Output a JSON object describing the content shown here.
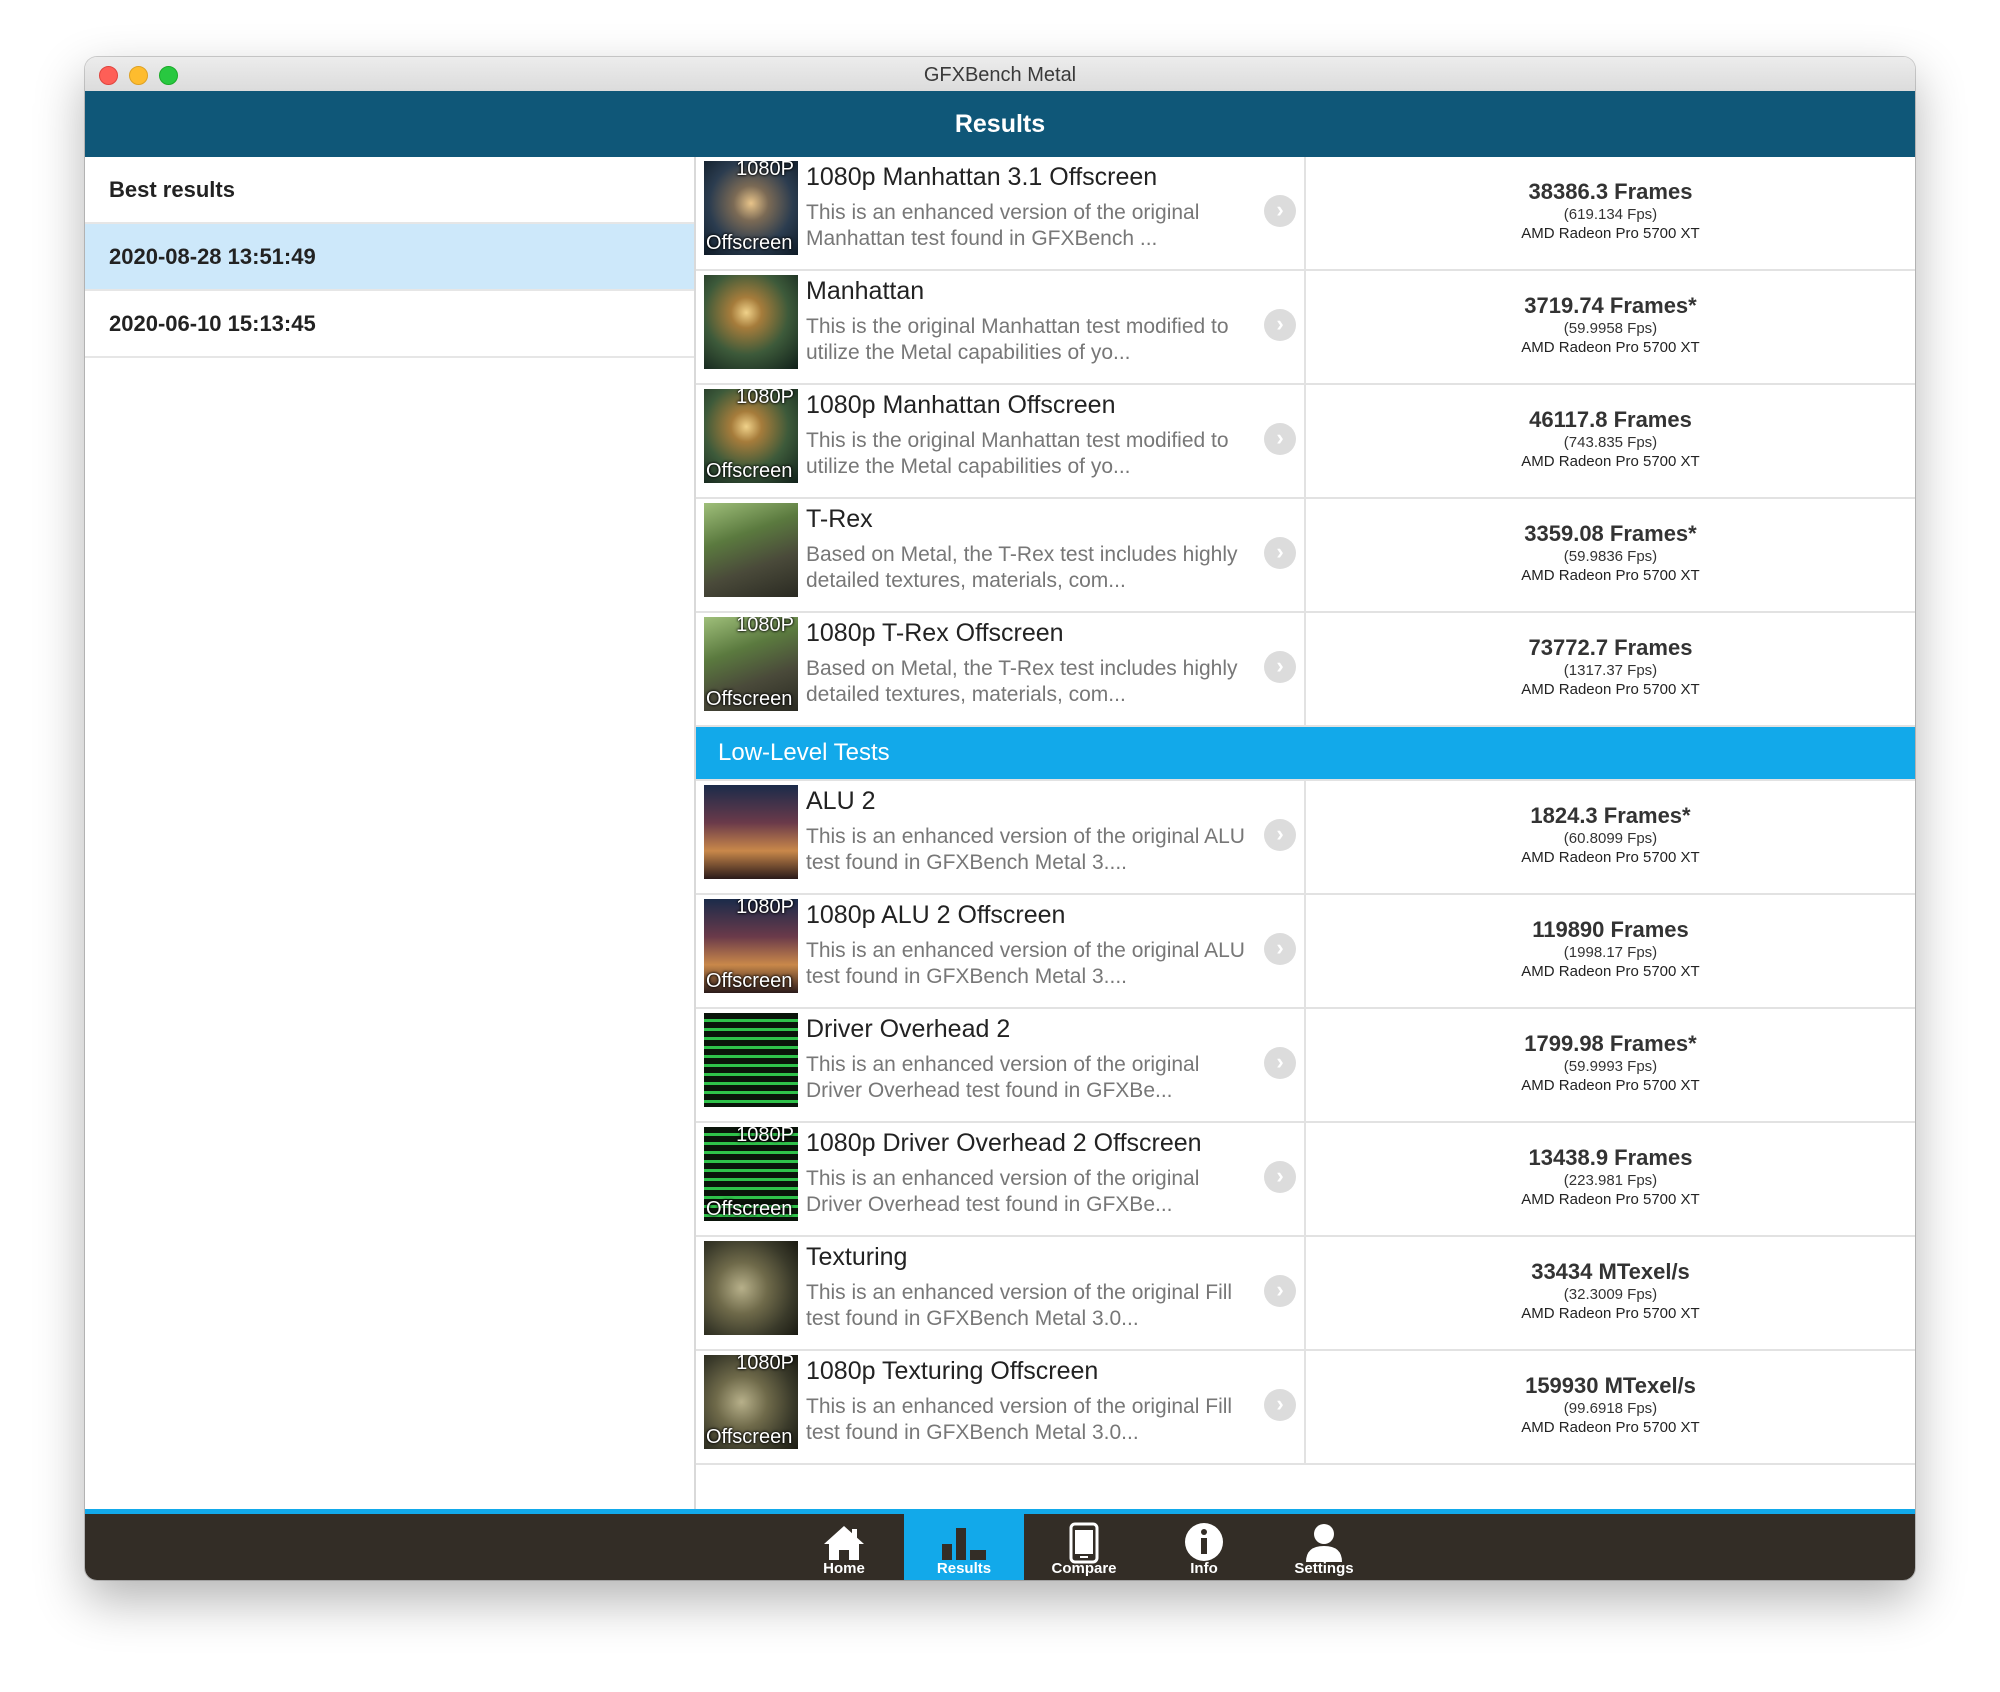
{
  "window": {
    "title": "GFXBench Metal"
  },
  "header": {
    "title": "Results"
  },
  "sidebar": {
    "items": [
      {
        "label": "Best results",
        "active": false
      },
      {
        "label": "2020-08-28 13:51:49",
        "active": true
      },
      {
        "label": "2020-06-10 15:13:45",
        "active": false
      }
    ]
  },
  "thumb_overlay": {
    "top": "1080P",
    "bottom": "Offscreen"
  },
  "section_low_level": "Low-Level Tests",
  "results_high": [
    {
      "title": "1080p Manhattan 3.1 Offscreen",
      "desc": "This is an enhanced version of the original Manhattan test found in GFXBench ...",
      "frames": "38386.3 Frames",
      "fps": "(619.134 Fps)",
      "gpu": "AMD Radeon Pro 5700 XT"
    },
    {
      "title": "Manhattan",
      "desc": "This is the original Manhattan test modified to utilize the Metal capabilities of yo...",
      "frames": "3719.74 Frames*",
      "fps": "(59.9958 Fps)",
      "gpu": "AMD Radeon Pro 5700 XT"
    },
    {
      "title": "1080p Manhattan Offscreen",
      "desc": "This is the original Manhattan test modified to utilize the Metal capabilities of yo...",
      "frames": "46117.8 Frames",
      "fps": "(743.835 Fps)",
      "gpu": "AMD Radeon Pro 5700 XT"
    },
    {
      "title": "T-Rex",
      "desc": "Based on Metal, the T-Rex test includes highly detailed textures, materials, com...",
      "frames": "3359.08 Frames*",
      "fps": "(59.9836 Fps)",
      "gpu": "AMD Radeon Pro 5700 XT"
    },
    {
      "title": "1080p T-Rex Offscreen",
      "desc": "Based on Metal, the T-Rex test includes highly detailed textures, materials, com...",
      "frames": "73772.7 Frames",
      "fps": "(1317.37 Fps)",
      "gpu": "AMD Radeon Pro 5700 XT"
    }
  ],
  "results_low": [
    {
      "title": "ALU 2",
      "desc": "This is an enhanced version of the original ALU test found in GFXBench Metal 3....",
      "frames": "1824.3 Frames*",
      "fps": "(60.8099 Fps)",
      "gpu": "AMD Radeon Pro 5700 XT"
    },
    {
      "title": "1080p ALU 2 Offscreen",
      "desc": "This is an enhanced version of the original ALU test found in GFXBench Metal 3....",
      "frames": "119890 Frames",
      "fps": "(1998.17 Fps)",
      "gpu": "AMD Radeon Pro 5700 XT"
    },
    {
      "title": "Driver Overhead 2",
      "desc": "This is an enhanced version of the original Driver Overhead test found in GFXBe...",
      "frames": "1799.98 Frames*",
      "fps": "(59.9993 Fps)",
      "gpu": "AMD Radeon Pro 5700 XT"
    },
    {
      "title": "1080p Driver Overhead 2 Offscreen",
      "desc": "This is an enhanced version of the original Driver Overhead test found in GFXBe...",
      "frames": "13438.9 Frames",
      "fps": "(223.981 Fps)",
      "gpu": "AMD Radeon Pro 5700 XT"
    },
    {
      "title": "Texturing",
      "desc": "This is an enhanced version of the original Fill test found in GFXBench Metal 3.0...",
      "frames": "33434 MTexel/s",
      "fps": "(32.3009 Fps)",
      "gpu": "AMD Radeon Pro 5700 XT"
    },
    {
      "title": "1080p Texturing Offscreen",
      "desc": "This is an enhanced version of the original Fill test found in GFXBench Metal 3.0...",
      "frames": "159930 MTexel/s",
      "fps": "(99.6918 Fps)",
      "gpu": "AMD Radeon Pro 5700 XT"
    }
  ],
  "tabs": [
    {
      "label": "Home",
      "icon": "home-icon"
    },
    {
      "label": "Results",
      "icon": "bar-chart-icon"
    },
    {
      "label": "Compare",
      "icon": "phone-icon"
    },
    {
      "label": "Info",
      "icon": "info-icon"
    },
    {
      "label": "Settings",
      "icon": "user-icon"
    }
  ]
}
